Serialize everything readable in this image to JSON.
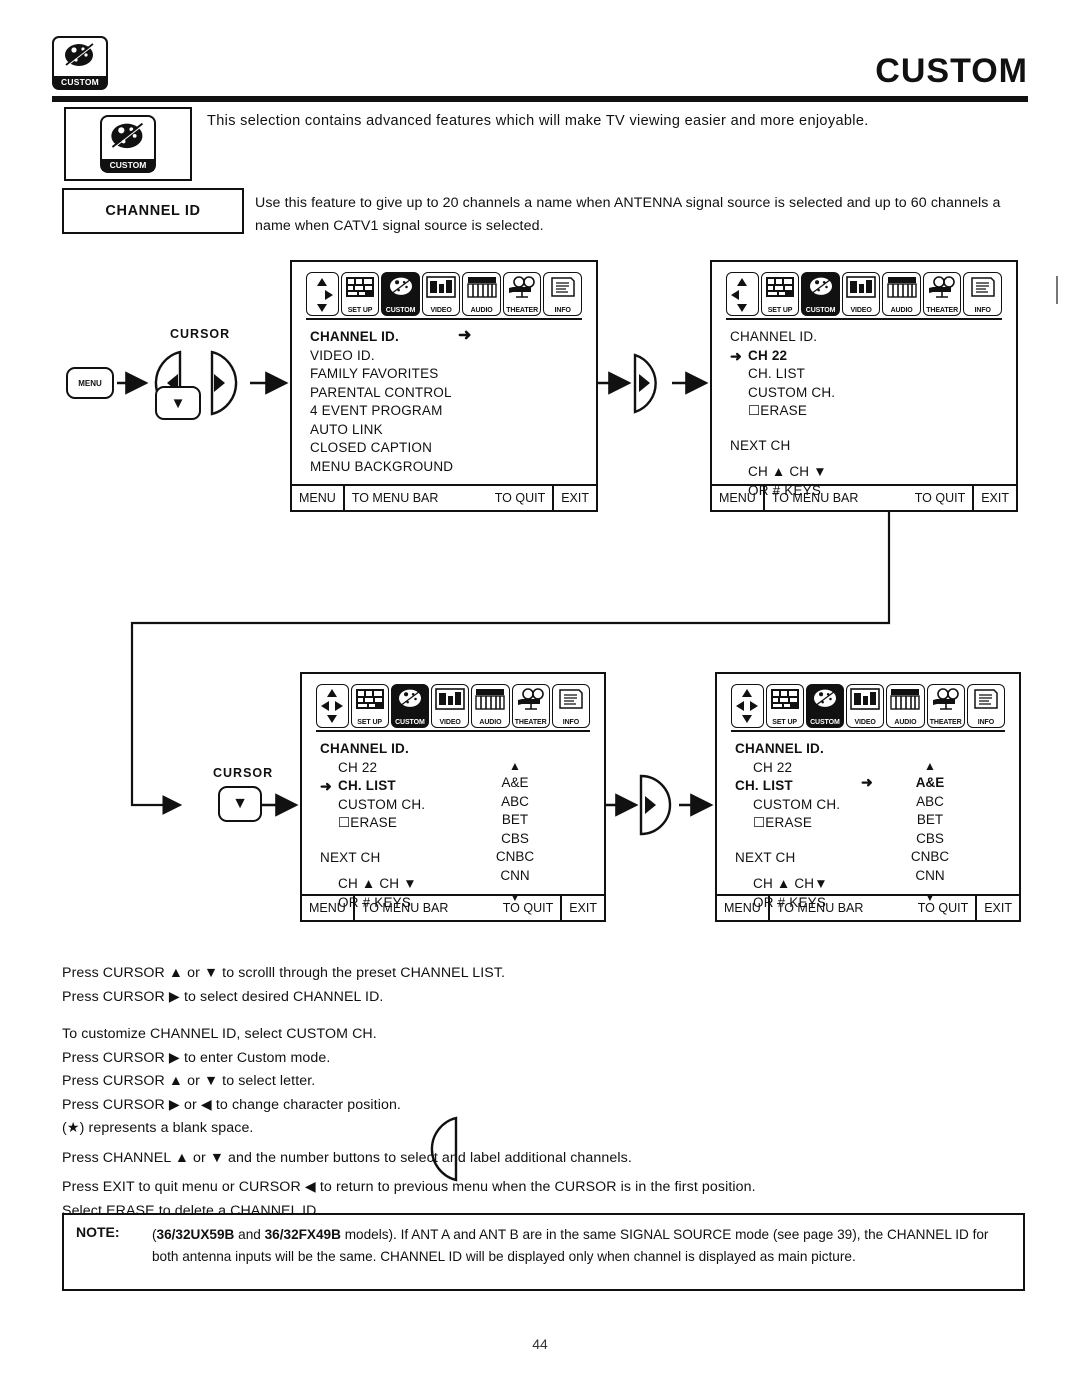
{
  "header": {
    "title": "CUSTOM",
    "badge_label": "CUSTOM",
    "badge_icon": "palette-icon"
  },
  "intro": {
    "icon_label": "CUSTOM",
    "text": "This selection contains advanced features which will make TV viewing easier and more enjoyable."
  },
  "channel_id_section": {
    "label": "CHANNEL ID",
    "description": "Use this feature to give up to 20 channels a name when ANTENNA signal source is selected and up to 60 channels a name when CATV1 signal source is selected."
  },
  "menu_bar": {
    "items": [
      {
        "label": "SET UP",
        "icon": "setup-grid-icon",
        "active": false
      },
      {
        "label": "CUSTOM",
        "icon": "palette-icon",
        "active": true
      },
      {
        "label": "VIDEO",
        "icon": "video-monitor-icon",
        "active": false
      },
      {
        "label": "AUDIO",
        "icon": "audio-piano-icon",
        "active": false
      },
      {
        "label": "THEATER",
        "icon": "theater-projector-icon",
        "active": false
      },
      {
        "label": "INFO",
        "icon": "info-document-icon",
        "active": false
      }
    ]
  },
  "footer_bar": {
    "menu": "MENU",
    "to_menu_bar": "TO MENU BAR",
    "to_quit": "TO QUIT",
    "exit": "EXIT"
  },
  "screens": [
    {
      "id": "screen-1-custom-menu",
      "cursor_pad": "up-down-right-pad",
      "items": [
        {
          "text": "CHANNEL ID.",
          "bold": true,
          "cursor": false,
          "trailing_arrow": true
        },
        {
          "text": "VIDEO ID.",
          "bold": false,
          "cursor": false
        },
        {
          "text": "FAMILY FAVORITES",
          "bold": false,
          "cursor": false
        },
        {
          "text": "PARENTAL CONTROL",
          "bold": false,
          "cursor": false
        },
        {
          "text": "4 EVENT PROGRAM",
          "bold": false,
          "cursor": false
        },
        {
          "text": "AUTO LINK",
          "bold": false,
          "cursor": false
        },
        {
          "text": "CLOSED CAPTION",
          "bold": false,
          "cursor": false
        },
        {
          "text": "MENU BACKGROUND",
          "bold": false,
          "cursor": false
        }
      ]
    },
    {
      "id": "screen-2-channel-id",
      "cursor_pad": "up-down-left-pad",
      "title": "CHANNEL ID.",
      "items": [
        {
          "text": "CH 22",
          "bold": true,
          "cursor": true
        },
        {
          "text": "CH. LIST",
          "bold": false,
          "cursor": false
        },
        {
          "text": "CUSTOM CH.",
          "bold": false,
          "cursor": false
        },
        {
          "text": "☐ERASE",
          "bold": false,
          "cursor": false
        }
      ],
      "next_ch_label": "NEXT CH",
      "hint_line_1": "CH ▲  CH ▼",
      "hint_line_2": "OR # KEYS"
    },
    {
      "id": "screen-3-ch-list",
      "cursor_pad": "four-way-pad",
      "title": "CHANNEL ID.",
      "items": [
        {
          "text": "CH 22",
          "bold": false,
          "cursor": false
        },
        {
          "text": "CH. LIST",
          "bold": true,
          "cursor": true
        },
        {
          "text": "CUSTOM CH.",
          "bold": false,
          "cursor": false
        },
        {
          "text": "☐ERASE",
          "bold": false,
          "cursor": false
        }
      ],
      "next_ch_label": "NEXT CH",
      "hint_line_1": "CH ▲  CH ▼",
      "hint_line_2": "OR # KEYS",
      "channel_list": {
        "scroll_up": "▲",
        "scroll_down": "▼",
        "entries": [
          {
            "name": "A&E",
            "cursor": false,
            "bold": false
          },
          {
            "name": "ABC",
            "cursor": false,
            "bold": false
          },
          {
            "name": "BET",
            "cursor": false,
            "bold": false
          },
          {
            "name": "CBS",
            "cursor": false,
            "bold": false
          },
          {
            "name": "CNBC",
            "cursor": false,
            "bold": false
          },
          {
            "name": "CNN",
            "cursor": false,
            "bold": false
          }
        ]
      }
    },
    {
      "id": "screen-4-ch-list-selected",
      "cursor_pad": "four-way-pad",
      "title": "CHANNEL ID.",
      "items": [
        {
          "text": "CH 22",
          "bold": false,
          "cursor": false
        },
        {
          "text": "CH. LIST",
          "bold": true,
          "cursor": false
        },
        {
          "text": "CUSTOM CH.",
          "bold": false,
          "cursor": false
        },
        {
          "text": "☐ERASE",
          "bold": false,
          "cursor": false
        }
      ],
      "next_ch_label": "NEXT CH",
      "hint_line_1": "CH ▲  CH▼",
      "hint_line_2": "OR # KEYS",
      "channel_list": {
        "scroll_up": "▲",
        "scroll_down": "▼",
        "entries": [
          {
            "name": "A&E",
            "cursor": true,
            "bold": true
          },
          {
            "name": "ABC",
            "cursor": false,
            "bold": false
          },
          {
            "name": "BET",
            "cursor": false,
            "bold": false
          },
          {
            "name": "CBS",
            "cursor": false,
            "bold": false
          },
          {
            "name": "CNBC",
            "cursor": false,
            "bold": false
          },
          {
            "name": "CNN",
            "cursor": false,
            "bold": false
          }
        ]
      }
    }
  ],
  "flow": {
    "cursor_label_top": "CURSOR",
    "cursor_label_bottom": "CURSOR",
    "menu_key_label": "MENU",
    "left_key": "◀",
    "down_key": "▼",
    "right_key": "▶"
  },
  "instructions": {
    "lines": [
      "Press CURSOR ▲ or ▼ to scrolll through the preset CHANNEL LIST.",
      "Press CURSOR ▶  to select desired CHANNEL ID.",
      "",
      "To customize CHANNEL ID, select CUSTOM CH.",
      "Press CURSOR ▶  to enter Custom mode.",
      "Press CURSOR ▲ or ▼ to select letter.",
      "Press CURSOR ▶ or ◀ to change character position.",
      "(★) represents a blank space.",
      "Press CHANNEL ▲ or ▼ and the number buttons to select and label additional channels.",
      "Press EXIT to quit menu or CURSOR ◀ to return to previous menu when the CURSOR is in the first position.",
      "Select ERASE to delete a CHANNEL ID."
    ]
  },
  "note": {
    "label": "NOTE:",
    "model_1": "36/32UX59B",
    "model_2": "36/32FX49B",
    "text_part_1": "(",
    "text_part_2": " and ",
    "text_part_3": " models). If ANT A and ANT B are in the same SIGNAL SOURCE mode (see page 39), the CHANNEL ID for both antenna inputs will be the same. CHANNEL ID will be displayed only when channel is displayed as main picture."
  },
  "page_number": "44"
}
